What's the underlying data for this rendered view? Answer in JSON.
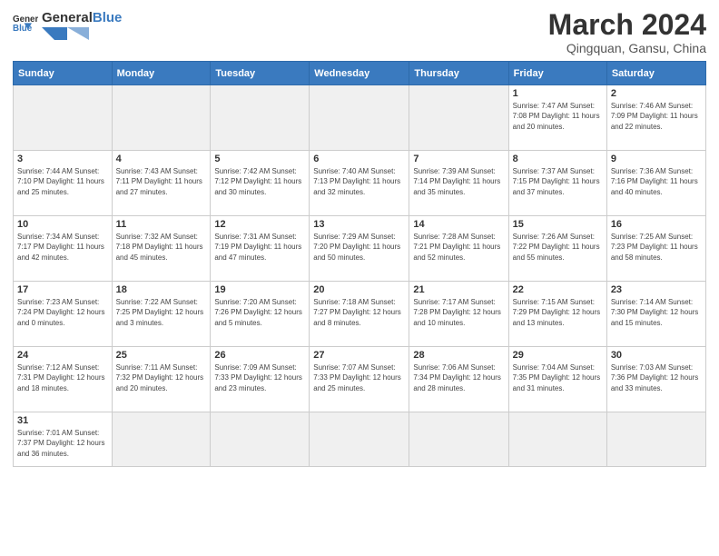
{
  "header": {
    "logo_general": "General",
    "logo_blue": "Blue",
    "month_title": "March 2024",
    "location": "Qingquan, Gansu, China"
  },
  "days_of_week": [
    "Sunday",
    "Monday",
    "Tuesday",
    "Wednesday",
    "Thursday",
    "Friday",
    "Saturday"
  ],
  "weeks": [
    [
      {
        "day": "",
        "info": ""
      },
      {
        "day": "",
        "info": ""
      },
      {
        "day": "",
        "info": ""
      },
      {
        "day": "",
        "info": ""
      },
      {
        "day": "",
        "info": ""
      },
      {
        "day": "1",
        "info": "Sunrise: 7:47 AM\nSunset: 7:08 PM\nDaylight: 11 hours\nand 20 minutes."
      },
      {
        "day": "2",
        "info": "Sunrise: 7:46 AM\nSunset: 7:09 PM\nDaylight: 11 hours\nand 22 minutes."
      }
    ],
    [
      {
        "day": "3",
        "info": "Sunrise: 7:44 AM\nSunset: 7:10 PM\nDaylight: 11 hours\nand 25 minutes."
      },
      {
        "day": "4",
        "info": "Sunrise: 7:43 AM\nSunset: 7:11 PM\nDaylight: 11 hours\nand 27 minutes."
      },
      {
        "day": "5",
        "info": "Sunrise: 7:42 AM\nSunset: 7:12 PM\nDaylight: 11 hours\nand 30 minutes."
      },
      {
        "day": "6",
        "info": "Sunrise: 7:40 AM\nSunset: 7:13 PM\nDaylight: 11 hours\nand 32 minutes."
      },
      {
        "day": "7",
        "info": "Sunrise: 7:39 AM\nSunset: 7:14 PM\nDaylight: 11 hours\nand 35 minutes."
      },
      {
        "day": "8",
        "info": "Sunrise: 7:37 AM\nSunset: 7:15 PM\nDaylight: 11 hours\nand 37 minutes."
      },
      {
        "day": "9",
        "info": "Sunrise: 7:36 AM\nSunset: 7:16 PM\nDaylight: 11 hours\nand 40 minutes."
      }
    ],
    [
      {
        "day": "10",
        "info": "Sunrise: 7:34 AM\nSunset: 7:17 PM\nDaylight: 11 hours\nand 42 minutes."
      },
      {
        "day": "11",
        "info": "Sunrise: 7:32 AM\nSunset: 7:18 PM\nDaylight: 11 hours\nand 45 minutes."
      },
      {
        "day": "12",
        "info": "Sunrise: 7:31 AM\nSunset: 7:19 PM\nDaylight: 11 hours\nand 47 minutes."
      },
      {
        "day": "13",
        "info": "Sunrise: 7:29 AM\nSunset: 7:20 PM\nDaylight: 11 hours\nand 50 minutes."
      },
      {
        "day": "14",
        "info": "Sunrise: 7:28 AM\nSunset: 7:21 PM\nDaylight: 11 hours\nand 52 minutes."
      },
      {
        "day": "15",
        "info": "Sunrise: 7:26 AM\nSunset: 7:22 PM\nDaylight: 11 hours\nand 55 minutes."
      },
      {
        "day": "16",
        "info": "Sunrise: 7:25 AM\nSunset: 7:23 PM\nDaylight: 11 hours\nand 58 minutes."
      }
    ],
    [
      {
        "day": "17",
        "info": "Sunrise: 7:23 AM\nSunset: 7:24 PM\nDaylight: 12 hours\nand 0 minutes."
      },
      {
        "day": "18",
        "info": "Sunrise: 7:22 AM\nSunset: 7:25 PM\nDaylight: 12 hours\nand 3 minutes."
      },
      {
        "day": "19",
        "info": "Sunrise: 7:20 AM\nSunset: 7:26 PM\nDaylight: 12 hours\nand 5 minutes."
      },
      {
        "day": "20",
        "info": "Sunrise: 7:18 AM\nSunset: 7:27 PM\nDaylight: 12 hours\nand 8 minutes."
      },
      {
        "day": "21",
        "info": "Sunrise: 7:17 AM\nSunset: 7:28 PM\nDaylight: 12 hours\nand 10 minutes."
      },
      {
        "day": "22",
        "info": "Sunrise: 7:15 AM\nSunset: 7:29 PM\nDaylight: 12 hours\nand 13 minutes."
      },
      {
        "day": "23",
        "info": "Sunrise: 7:14 AM\nSunset: 7:30 PM\nDaylight: 12 hours\nand 15 minutes."
      }
    ],
    [
      {
        "day": "24",
        "info": "Sunrise: 7:12 AM\nSunset: 7:31 PM\nDaylight: 12 hours\nand 18 minutes."
      },
      {
        "day": "25",
        "info": "Sunrise: 7:11 AM\nSunset: 7:32 PM\nDaylight: 12 hours\nand 20 minutes."
      },
      {
        "day": "26",
        "info": "Sunrise: 7:09 AM\nSunset: 7:33 PM\nDaylight: 12 hours\nand 23 minutes."
      },
      {
        "day": "27",
        "info": "Sunrise: 7:07 AM\nSunset: 7:33 PM\nDaylight: 12 hours\nand 25 minutes."
      },
      {
        "day": "28",
        "info": "Sunrise: 7:06 AM\nSunset: 7:34 PM\nDaylight: 12 hours\nand 28 minutes."
      },
      {
        "day": "29",
        "info": "Sunrise: 7:04 AM\nSunset: 7:35 PM\nDaylight: 12 hours\nand 31 minutes."
      },
      {
        "day": "30",
        "info": "Sunrise: 7:03 AM\nSunset: 7:36 PM\nDaylight: 12 hours\nand 33 minutes."
      }
    ],
    [
      {
        "day": "31",
        "info": "Sunrise: 7:01 AM\nSunset: 7:37 PM\nDaylight: 12 hours\nand 36 minutes."
      },
      {
        "day": "",
        "info": ""
      },
      {
        "day": "",
        "info": ""
      },
      {
        "day": "",
        "info": ""
      },
      {
        "day": "",
        "info": ""
      },
      {
        "day": "",
        "info": ""
      },
      {
        "day": "",
        "info": ""
      }
    ]
  ]
}
